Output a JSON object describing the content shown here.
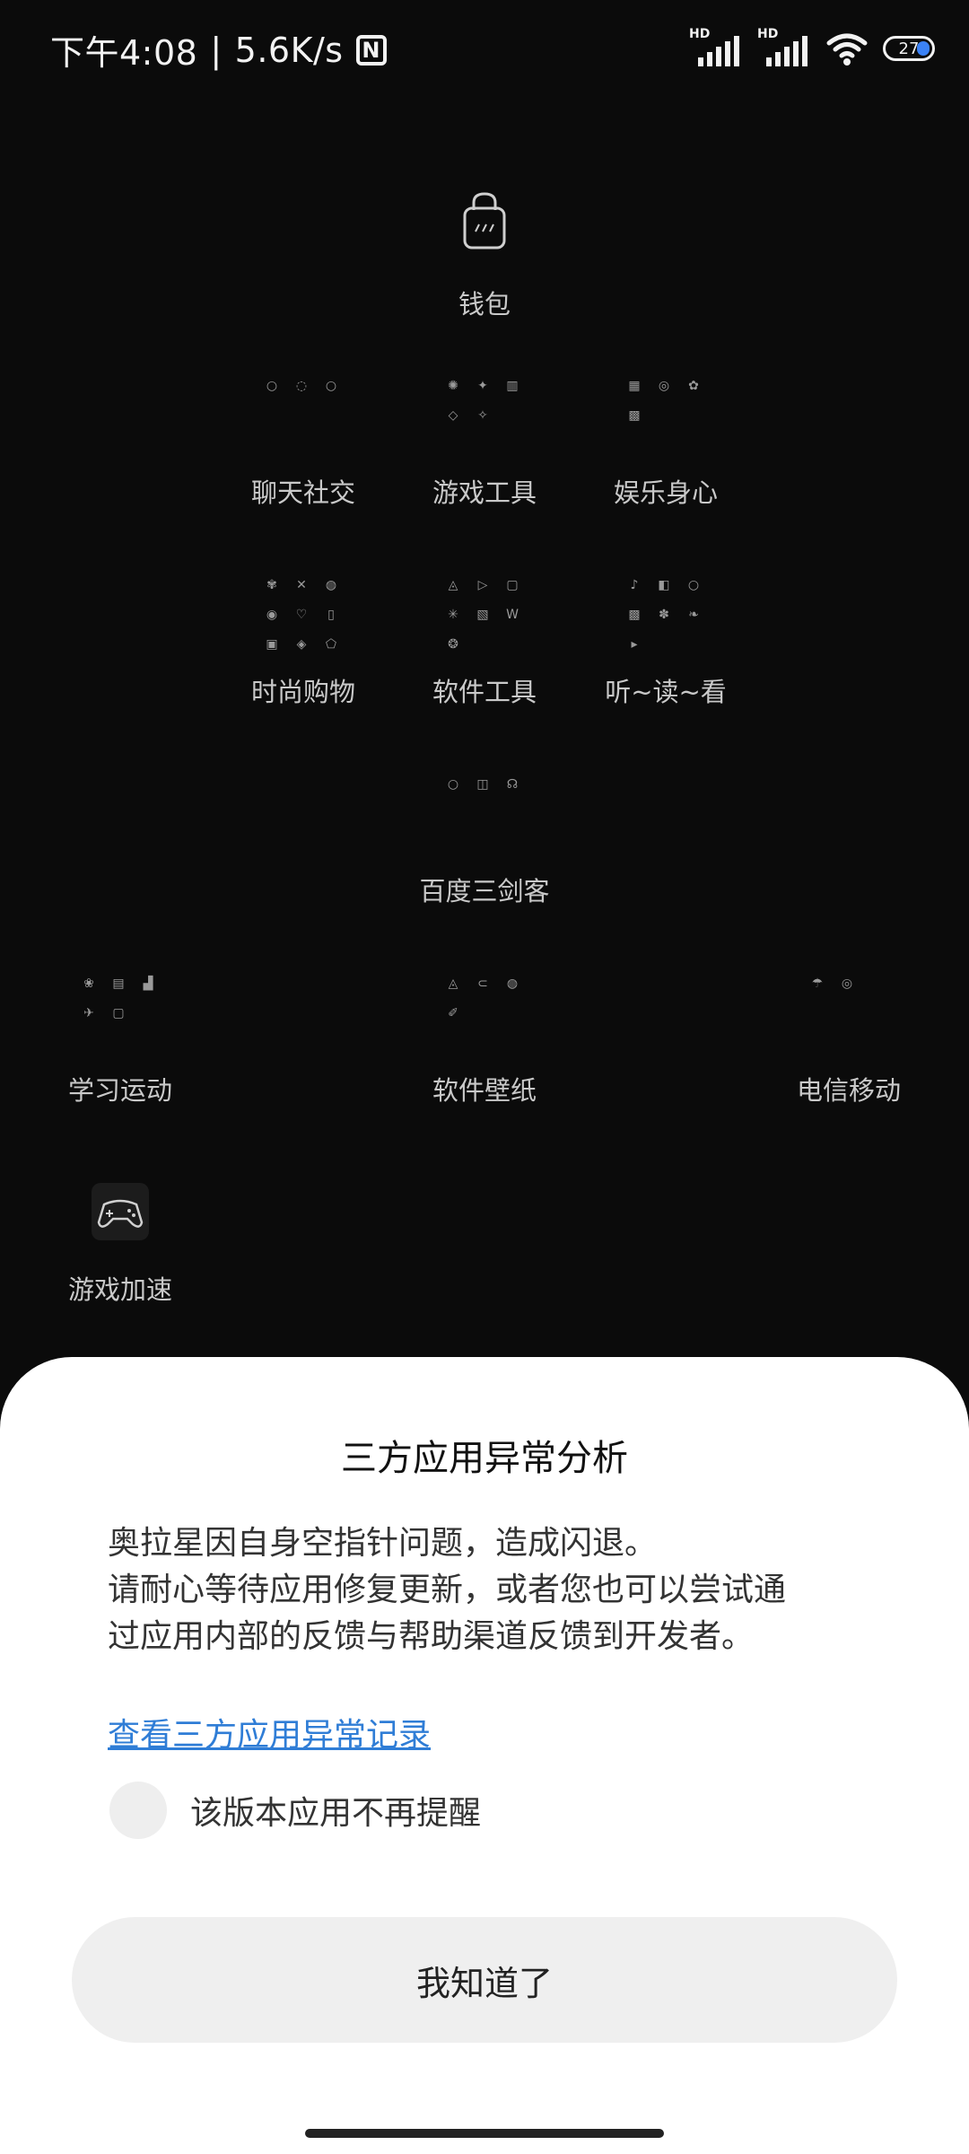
{
  "status_bar": {
    "time": "下午4:08",
    "separator": "|",
    "net_speed": "5.6K/s",
    "nfc_label": "N",
    "hd_label_1": "HD",
    "hd_label_2": "HD",
    "battery": "27",
    "battery_color": "#3b82f6"
  },
  "home": {
    "folders": {
      "wallet": "钱包",
      "chat": "聊天社交",
      "game_tools": "游戏工具",
      "entertainment": "娱乐身心",
      "shopping": "时尚购物",
      "software_tools": "软件工具",
      "listen_read_watch": "听~读~看",
      "baidu": "百度三剑客",
      "study_sport": "学习运动",
      "software_wallpaper": "软件壁纸",
      "telecom": "电信移动",
      "game_boost": "游戏加速"
    }
  },
  "dialog": {
    "title": "三方应用异常分析",
    "message_lines": [
      "奥拉星因自身空指针问题，造成闪退。",
      "请耐心等待应用修复更新，或者您也可以尝试通",
      "过应用内部的反馈与帮助渠道反馈到开发者。"
    ],
    "link": "查看三方应用异常记录",
    "checkbox_label": "该版本应用不再提醒",
    "confirm_button": "我知道了",
    "link_color": "#2f7dd6"
  }
}
